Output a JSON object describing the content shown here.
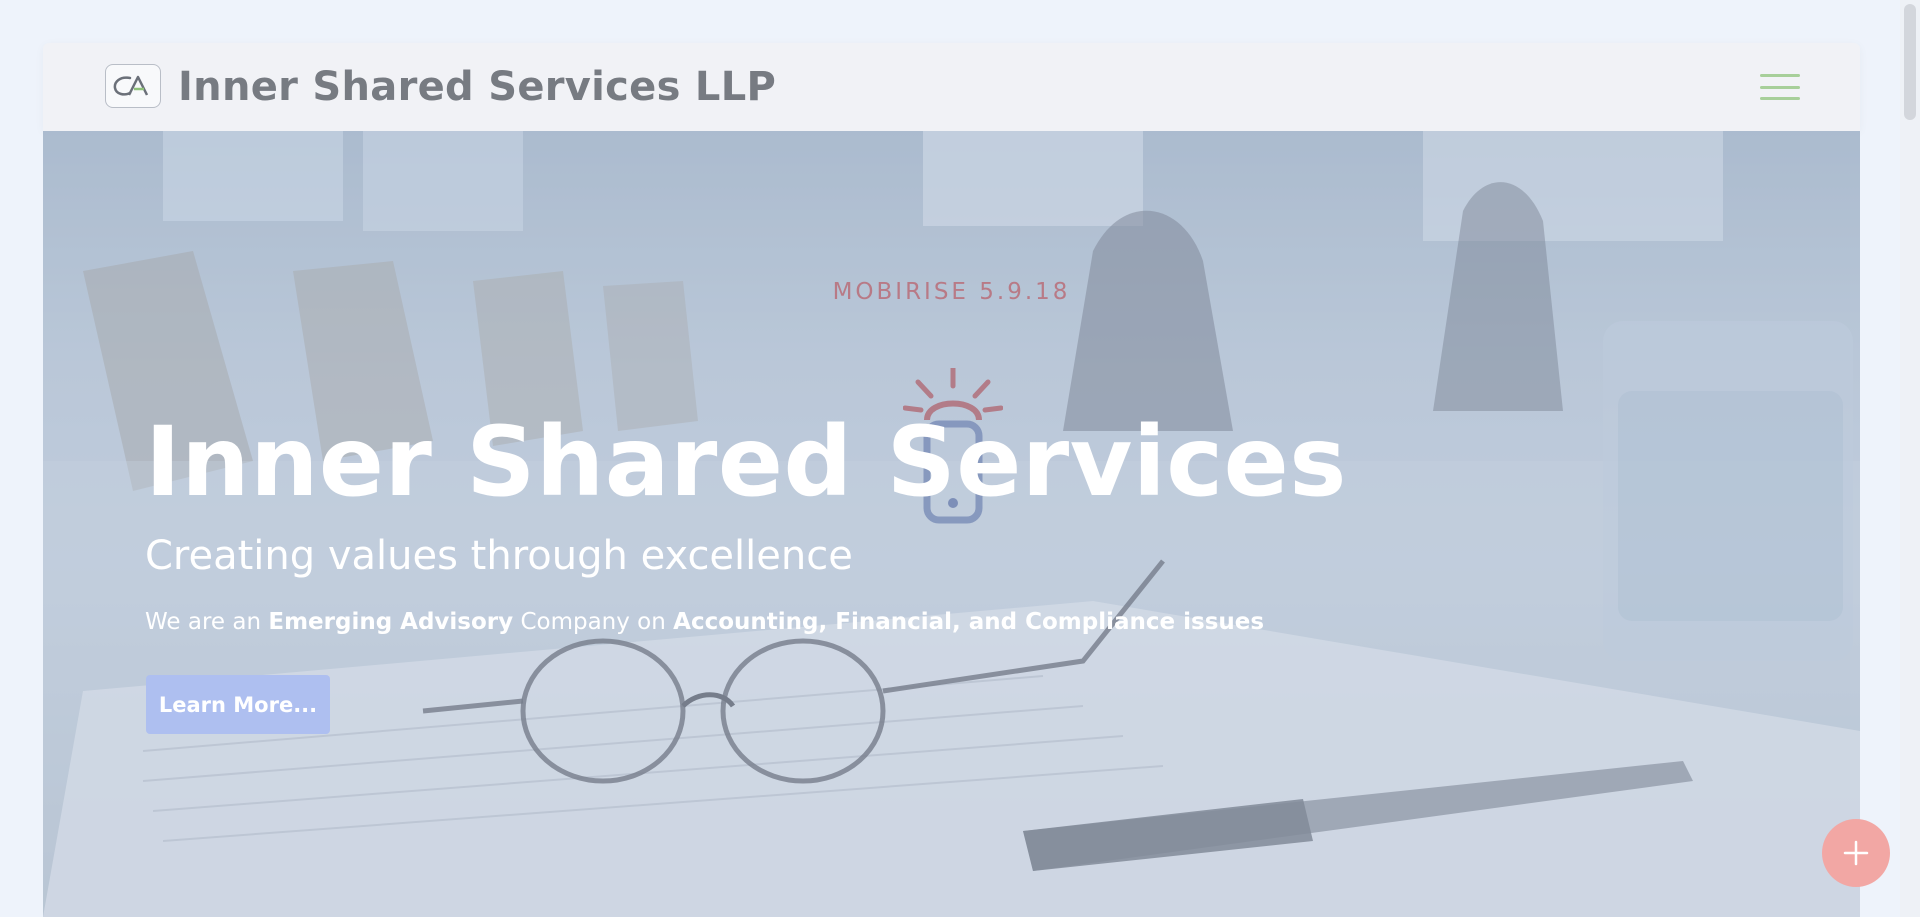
{
  "navbar": {
    "brand": "Inner Shared Services LLP",
    "logo_text": "CA",
    "logo_icon": "ca-logo-icon",
    "menu_icon": "hamburger-menu-icon"
  },
  "hero": {
    "badge": "MOBIRISE  5.9.18",
    "title": "Inner Shared Services",
    "subtitle": "Creating values through excellence",
    "text": {
      "p1": "We are an ",
      "b1": "Emerging Advisory",
      "p2": " Company on ",
      "b2": "Accounting, Financial, and Compliance issues"
    },
    "button": "Learn More...",
    "center_icon": "mobile-phone-signal-icon"
  },
  "fab": {
    "icon": "plus-icon"
  },
  "colors": {
    "accent": "#aebff0",
    "fab": "#f2a7a4",
    "badge": "#b87a86",
    "menu": "#a7cf9a"
  }
}
